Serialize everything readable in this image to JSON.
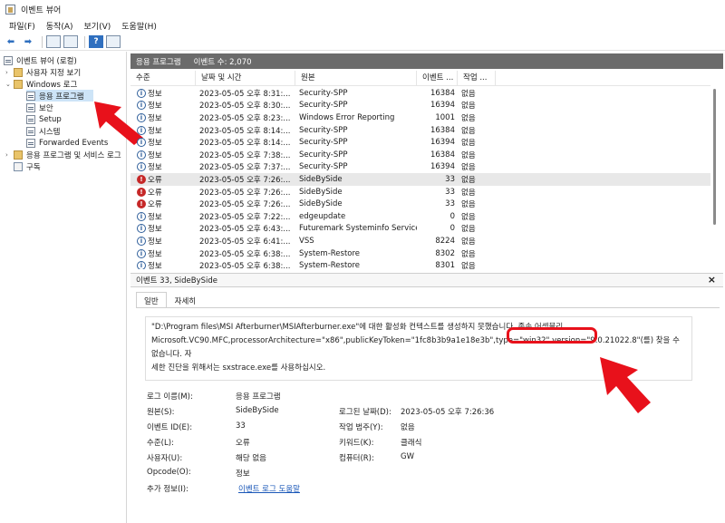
{
  "window": {
    "title": "이벤트 뷰어"
  },
  "menu": [
    "파일(F)",
    "동작(A)",
    "보기(V)",
    "도움말(H)"
  ],
  "toolbar": {
    "help_label": "?"
  },
  "tree": [
    {
      "label": "이벤트 뷰어 (로컬)",
      "icon": "event-viewer-icon"
    },
    {
      "label": "사용자 지정 보기",
      "icon": "folder-icon",
      "expander": "›"
    },
    {
      "label": "Windows 로그",
      "icon": "folder-icon",
      "expander": "⌄"
    },
    {
      "label": "응용 프로그램",
      "icon": "log-icon",
      "selected": true
    },
    {
      "label": "보안",
      "icon": "log-icon"
    },
    {
      "label": "Setup",
      "icon": "log-icon"
    },
    {
      "label": "시스템",
      "icon": "log-icon"
    },
    {
      "label": "Forwarded Events",
      "icon": "log-icon"
    },
    {
      "label": "응용 프로그램 및 서비스 로그",
      "icon": "folder-icon",
      "expander": "›"
    },
    {
      "label": "구독",
      "icon": "subscription-icon"
    }
  ],
  "list": {
    "title": "응용 프로그램",
    "count": "이벤트 수: 2,070",
    "columns": [
      "수준",
      "날짜 및 시간",
      "원본",
      "이벤트 ...",
      "작업 ..."
    ],
    "rows": [
      {
        "level": "정보",
        "type": "info",
        "date": "2023-05-05 오후 8:31:...",
        "source": "Security-SPP",
        "id": "16384",
        "task": "없음"
      },
      {
        "level": "정보",
        "type": "info",
        "date": "2023-05-05 오후 8:30:...",
        "source": "Security-SPP",
        "id": "16394",
        "task": "없음"
      },
      {
        "level": "정보",
        "type": "info",
        "date": "2023-05-05 오후 8:23:...",
        "source": "Windows Error Reporting",
        "id": "1001",
        "task": "없음"
      },
      {
        "level": "정보",
        "type": "info",
        "date": "2023-05-05 오후 8:14:...",
        "source": "Security-SPP",
        "id": "16384",
        "task": "없음"
      },
      {
        "level": "정보",
        "type": "info",
        "date": "2023-05-05 오후 8:14:...",
        "source": "Security-SPP",
        "id": "16394",
        "task": "없음"
      },
      {
        "level": "정보",
        "type": "info",
        "date": "2023-05-05 오후 7:38:...",
        "source": "Security-SPP",
        "id": "16384",
        "task": "없음"
      },
      {
        "level": "정보",
        "type": "info",
        "date": "2023-05-05 오후 7:37:...",
        "source": "Security-SPP",
        "id": "16394",
        "task": "없음"
      },
      {
        "level": "오류",
        "type": "err",
        "date": "2023-05-05 오후 7:26:...",
        "source": "SideBySide",
        "id": "33",
        "task": "없음",
        "selected": true
      },
      {
        "level": "오류",
        "type": "err",
        "date": "2023-05-05 오후 7:26:...",
        "source": "SideBySide",
        "id": "33",
        "task": "없음"
      },
      {
        "level": "오류",
        "type": "err",
        "date": "2023-05-05 오후 7:26:...",
        "source": "SideBySide",
        "id": "33",
        "task": "없음"
      },
      {
        "level": "정보",
        "type": "info",
        "date": "2023-05-05 오후 7:22:...",
        "source": "edgeupdate",
        "id": "0",
        "task": "없음"
      },
      {
        "level": "정보",
        "type": "info",
        "date": "2023-05-05 오후 6:43:...",
        "source": "Futuremark Systeminfo Service",
        "id": "0",
        "task": "없음"
      },
      {
        "level": "정보",
        "type": "info",
        "date": "2023-05-05 오후 6:41:...",
        "source": "VSS",
        "id": "8224",
        "task": "없음"
      },
      {
        "level": "정보",
        "type": "info",
        "date": "2023-05-05 오후 6:38:...",
        "source": "System-Restore",
        "id": "8302",
        "task": "없음"
      },
      {
        "level": "정보",
        "type": "info",
        "date": "2023-05-05 오후 6:38:...",
        "source": "System-Restore",
        "id": "8301",
        "task": "없음"
      }
    ]
  },
  "detail": {
    "header": "이벤트 33, SideBySide",
    "close": "×",
    "tabs": [
      "일반",
      "자세히"
    ],
    "description_line1": "\"D:\\Program files\\MSI Afterburner\\MSIAfterburner.exe\"에 대한 활성화 컨텍스트를 생성하지 못했습니다. 종속 어셈블리",
    "description_line2": "Microsoft.VC90.MFC,processorArchitecture=\"x86\",publicKeyToken=\"1fc8b3b9a1e18e3b\",type=\"win32\",version=\"9.0.21022.8\"(를) 찾을 수 없습니다. 자",
    "description_line3": "세한 진단을 위해서는 sxstrace.exe를 사용하십시오.",
    "props": {
      "log_name_label": "로그 이름(M):",
      "log_name": "응용 프로그램",
      "source_label": "원본(S):",
      "source": "SideBySide",
      "logged_label": "로그된 날짜(D):",
      "logged": "2023-05-05 오후 7:26:36",
      "event_id_label": "이벤트 ID(E):",
      "event_id": "33",
      "task_label": "작업 범주(Y):",
      "task": "없음",
      "level_label": "수준(L):",
      "level": "오류",
      "keywords_label": "키워드(K):",
      "keywords": "클래식",
      "user_label": "사용자(U):",
      "user": "해당 없음",
      "computer_label": "컴퓨터(R):",
      "computer": "GW",
      "opcode_label": "Opcode(O):",
      "opcode": "정보",
      "more_label": "추가 정보(I):",
      "more_link": "이벤트 로그 도움말"
    }
  },
  "colors": {
    "annotation": "#e8111b",
    "header_bar": "#6b6b6b",
    "selection": "#cde4f7"
  }
}
